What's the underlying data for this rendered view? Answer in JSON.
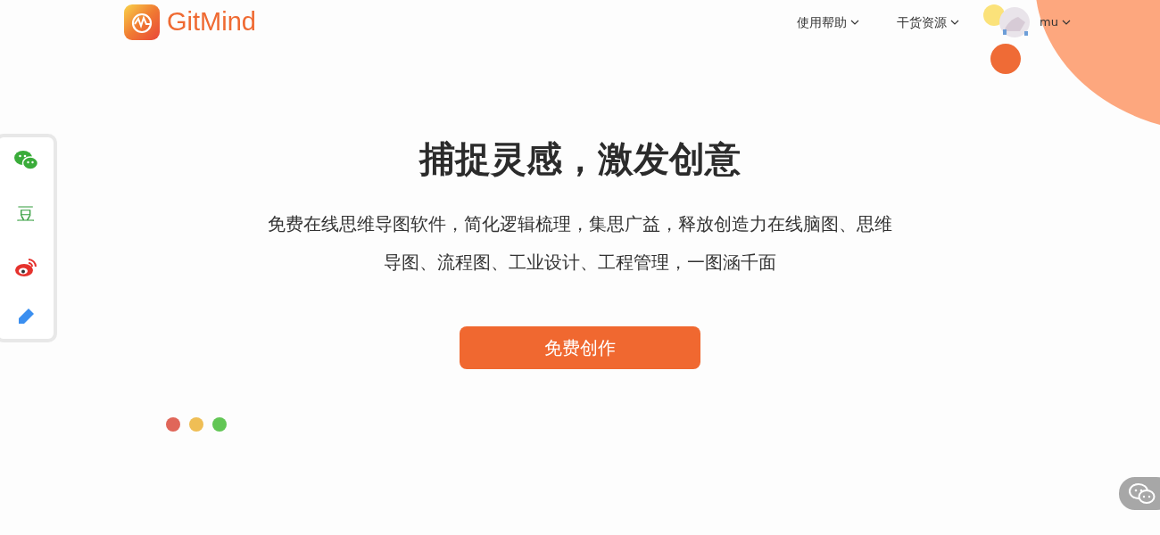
{
  "header": {
    "logo_text": "GitMind",
    "nav": [
      {
        "label": "使用帮助"
      },
      {
        "label": "干货资源"
      }
    ],
    "user": {
      "name": "mu"
    }
  },
  "share_bar": {
    "items": [
      {
        "kind": "wechat"
      },
      {
        "kind": "text",
        "text": "豆"
      },
      {
        "kind": "weibo"
      },
      {
        "kind": "pen"
      }
    ]
  },
  "hero": {
    "title": "捕捉灵感，激发创意",
    "description": "免费在线思维导图软件，简化逻辑梳理，集思广益，释放创造力在线脑图、思维导图、流程图、工业设计、工程管理，一图涵千面",
    "cta": "免费创作"
  },
  "window_dots": [
    {
      "color": "#e06659"
    },
    {
      "color": "#efbe55"
    },
    {
      "color": "#62c655"
    }
  ],
  "chat_button": {
    "kind": "wechat"
  }
}
